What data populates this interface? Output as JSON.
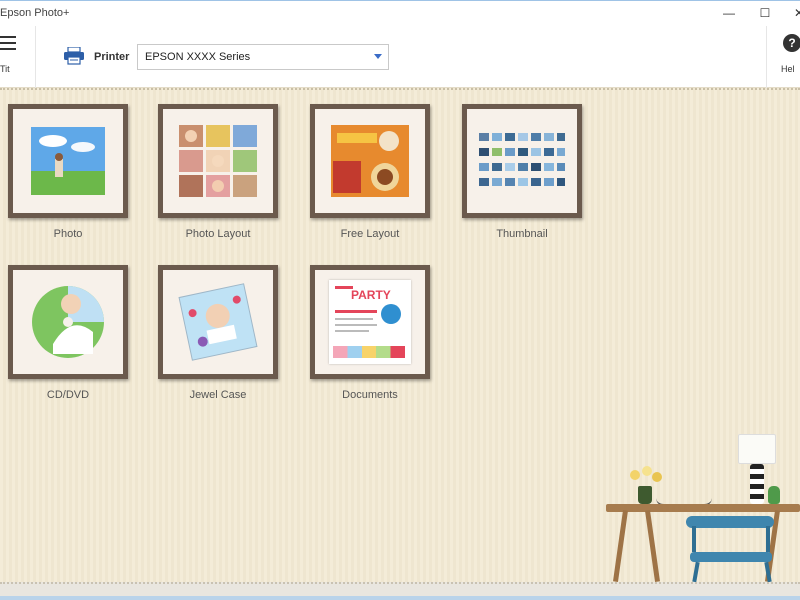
{
  "window": {
    "title": "Epson Photo+",
    "controls": {
      "minimize": "—",
      "maximize": "☐",
      "close": "✕"
    }
  },
  "toolbar": {
    "menu_label": "Tit",
    "printer_label": "Printer",
    "printer_selected": "EPSON XXXX Series",
    "help_symbol": "?",
    "help_label": "Hel"
  },
  "icons": {
    "menu": "hamburger-icon",
    "printer": "printer-icon",
    "help": "help-icon",
    "dropdown": "chevron-down-icon"
  },
  "tiles": [
    {
      "id": "photo",
      "label": "Photo"
    },
    {
      "id": "photo-layout",
      "label": "Photo Layout"
    },
    {
      "id": "free-layout",
      "label": "Free Layout"
    },
    {
      "id": "thumbnail",
      "label": "Thumbnail"
    },
    {
      "id": "cd-dvd",
      "label": "CD/DVD"
    },
    {
      "id": "jewel-case",
      "label": "Jewel Case"
    },
    {
      "id": "documents",
      "label": "Documents"
    }
  ],
  "documents_thumb_text": "PARTY",
  "colors": {
    "frame": "#6b5a4d",
    "wall": "#f3ead6",
    "accent_blue": "#3a6cc7"
  }
}
